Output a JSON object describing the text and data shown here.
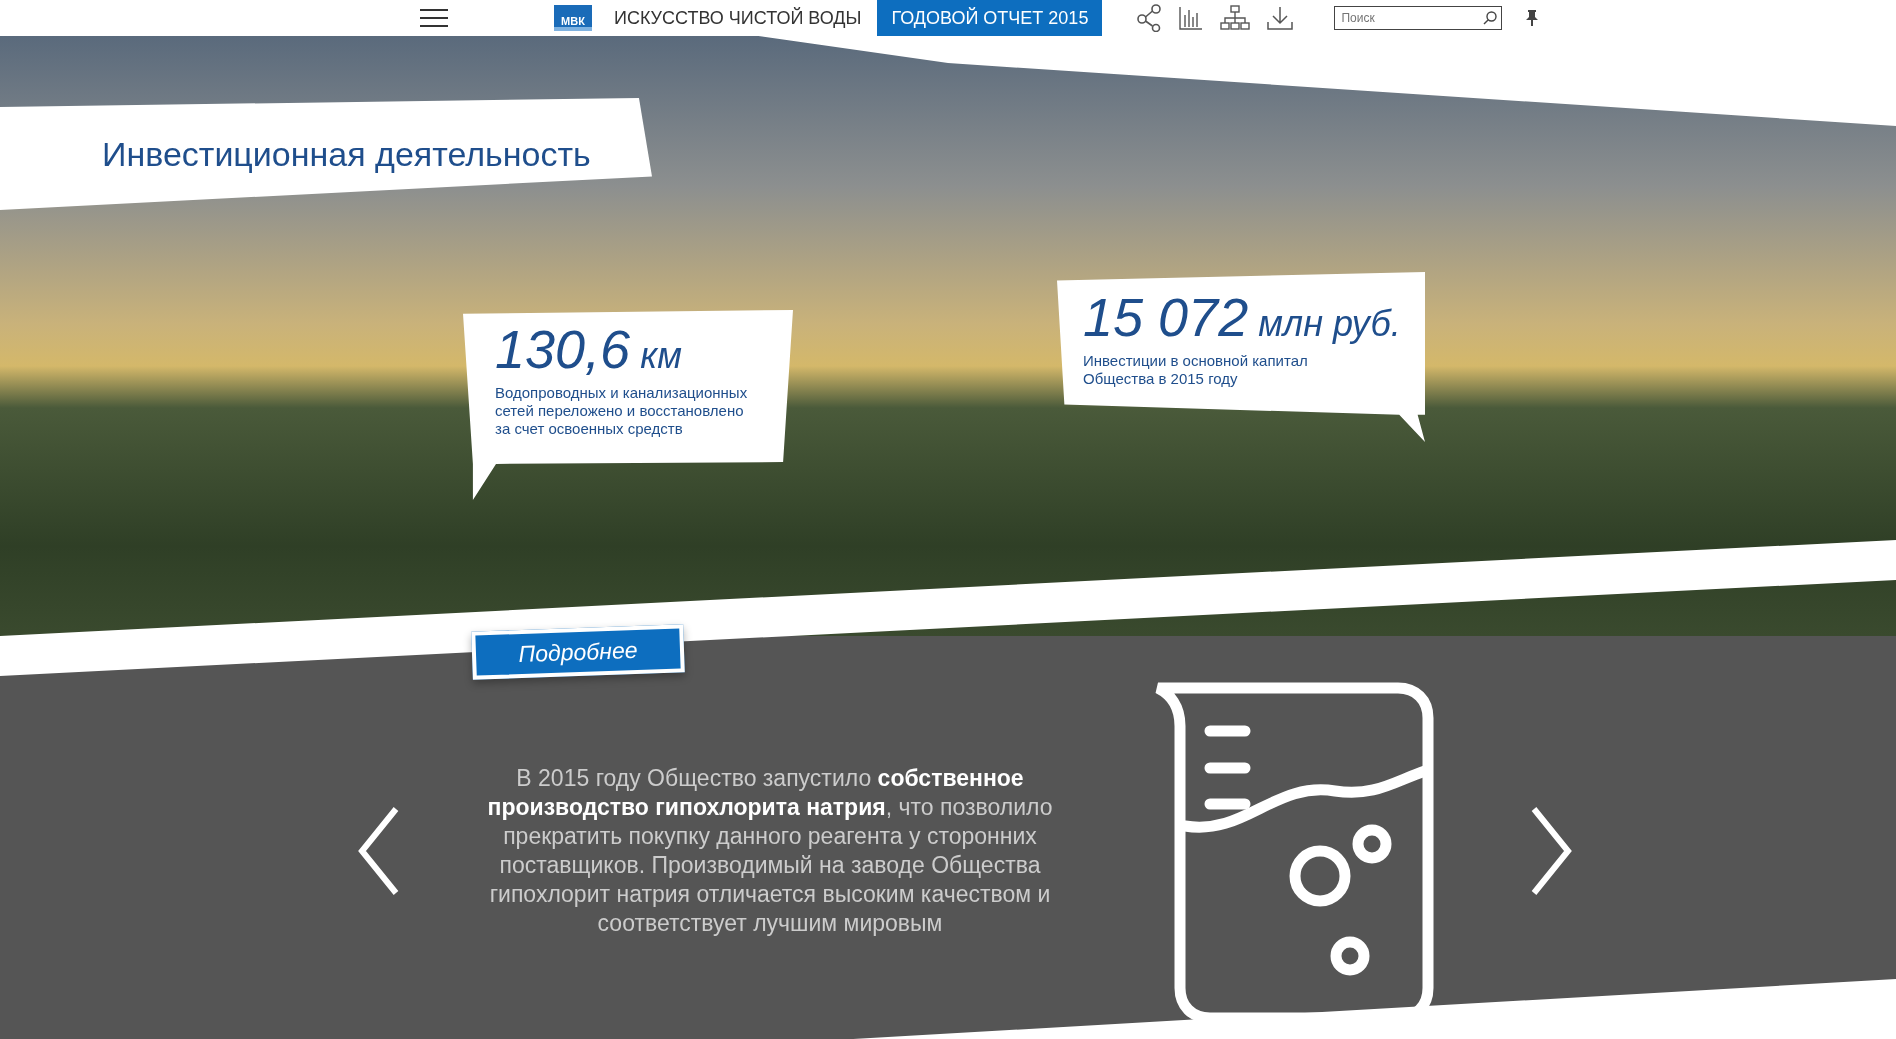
{
  "header": {
    "logo": "МВК",
    "site_title": "ИСКУССТВО ЧИСТОЙ ВОДЫ",
    "report_badge": "ГОДОВОЙ ОТЧЕТ 2015",
    "search": {
      "placeholder": "Поиск"
    }
  },
  "hero": {
    "title": "Инвестиционная деятельность",
    "stats": [
      {
        "value": "130,6",
        "unit": "км",
        "caption": "Водопроводных и канализационных\nсетей переложено и восстановлено\nза счет освоенных средств"
      },
      {
        "value": "15 072",
        "unit": "млн руб.",
        "caption": "Инвестиции в основной капитал\nОбщества в 2015 году"
      }
    ],
    "more_button": "Подробнее"
  },
  "slide": {
    "text": "В 2015 году Общество запустило **собственное производство гипохлорита натрия**, что позволило прекратить покупку данного реагента у сторонних поставщиков. Производимый на заводе Общества гипохлорит натрия отличается высоким качеством и соответствует лучшим мировым"
  }
}
